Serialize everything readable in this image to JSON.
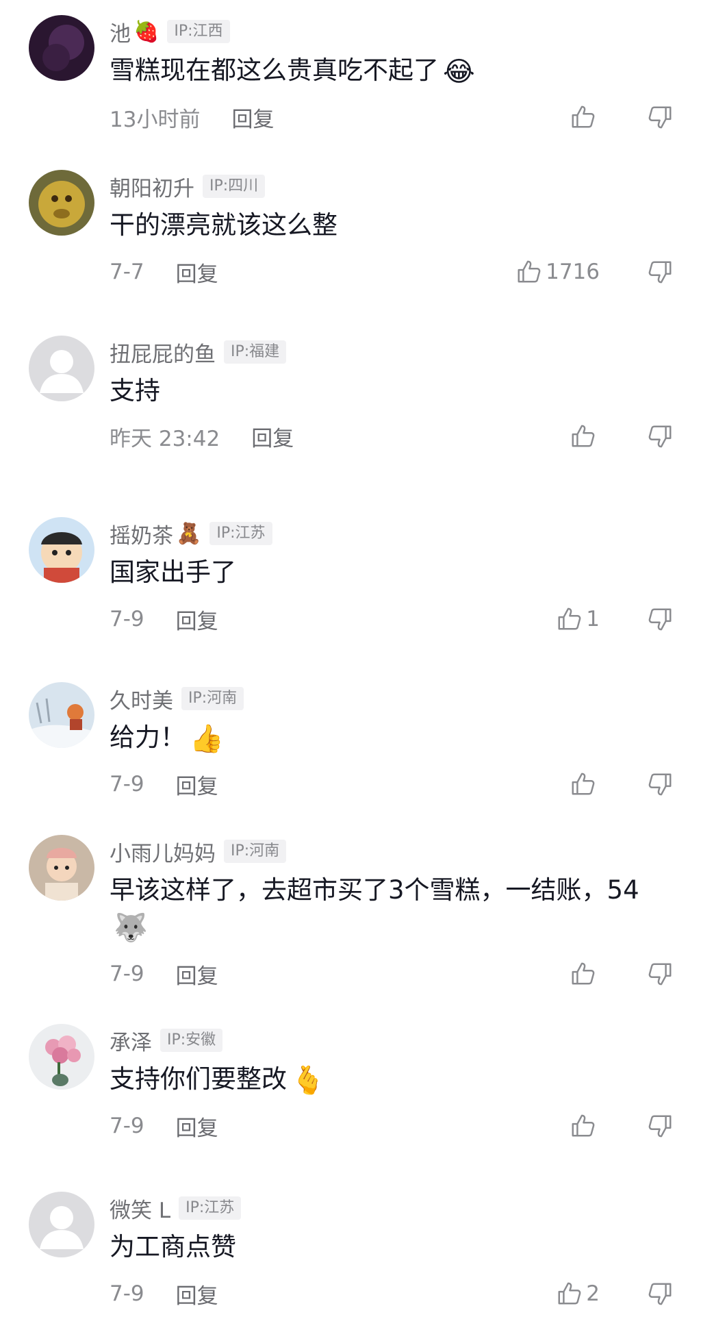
{
  "comments": [
    {
      "username": "池",
      "name_emoji": "🍓",
      "ip": "IP:江西",
      "text": "雪糕现在都这么贵真吃不起了",
      "text_emoji": "😂",
      "time": "13小时前",
      "reply_label": "回复",
      "like_count": ""
    },
    {
      "username": "朝阳初升",
      "name_emoji": "",
      "ip": "IP:四川",
      "text": "干的漂亮就该这么整",
      "text_emoji": "",
      "time": "7-7",
      "reply_label": "回复",
      "like_count": "1716"
    },
    {
      "username": "扭屁屁的鱼",
      "name_emoji": "",
      "ip": "IP:福建",
      "text": "支持",
      "text_emoji": "",
      "time": "昨天 23:42",
      "reply_label": "回复",
      "like_count": ""
    },
    {
      "username": "摇奶茶",
      "name_emoji": "🧸",
      "ip": "IP:江苏",
      "text": "国家出手了",
      "text_emoji": "",
      "time": "7-9",
      "reply_label": "回复",
      "like_count": "1"
    },
    {
      "username": "久时美",
      "name_emoji": "",
      "ip": "IP:河南",
      "text": "给力！",
      "text_emoji": "👍",
      "time": "7-9",
      "reply_label": "回复",
      "like_count": ""
    },
    {
      "username": "小雨儿妈妈",
      "name_emoji": "",
      "ip": "IP:河南",
      "text": "早该这样了，去超市买了3个雪糕，一结账，54",
      "text_emoji": "🐺",
      "time": "7-9",
      "reply_label": "回复",
      "like_count": ""
    },
    {
      "username": "承泽",
      "name_emoji": "",
      "ip": "IP:安徽",
      "text": "支持你们要整改",
      "text_emoji": "🫰",
      "time": "7-9",
      "reply_label": "回复",
      "like_count": ""
    },
    {
      "username": "微笑 L",
      "name_emoji": "",
      "ip": "IP:江苏",
      "text": "为工商点赞",
      "text_emoji": "",
      "time": "7-9",
      "reply_label": "回复",
      "like_count": "2"
    }
  ]
}
